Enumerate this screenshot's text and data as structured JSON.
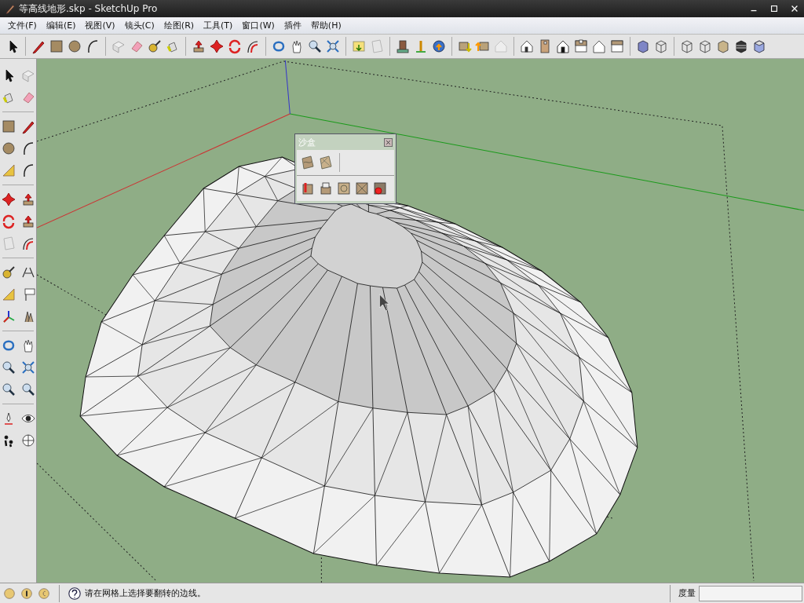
{
  "window": {
    "title": "等高线地形.skp - SketchUp Pro"
  },
  "menu": [
    "文件(F)",
    "编辑(E)",
    "视图(V)",
    "镜头(C)",
    "绘图(R)",
    "工具(T)",
    "窗口(W)",
    "插件",
    "帮助(H)"
  ],
  "sandbox": {
    "title": "沙盒"
  },
  "status_bar": {
    "message": "请在网格上选择要翻转的边线。",
    "measure_label": "度量"
  }
}
